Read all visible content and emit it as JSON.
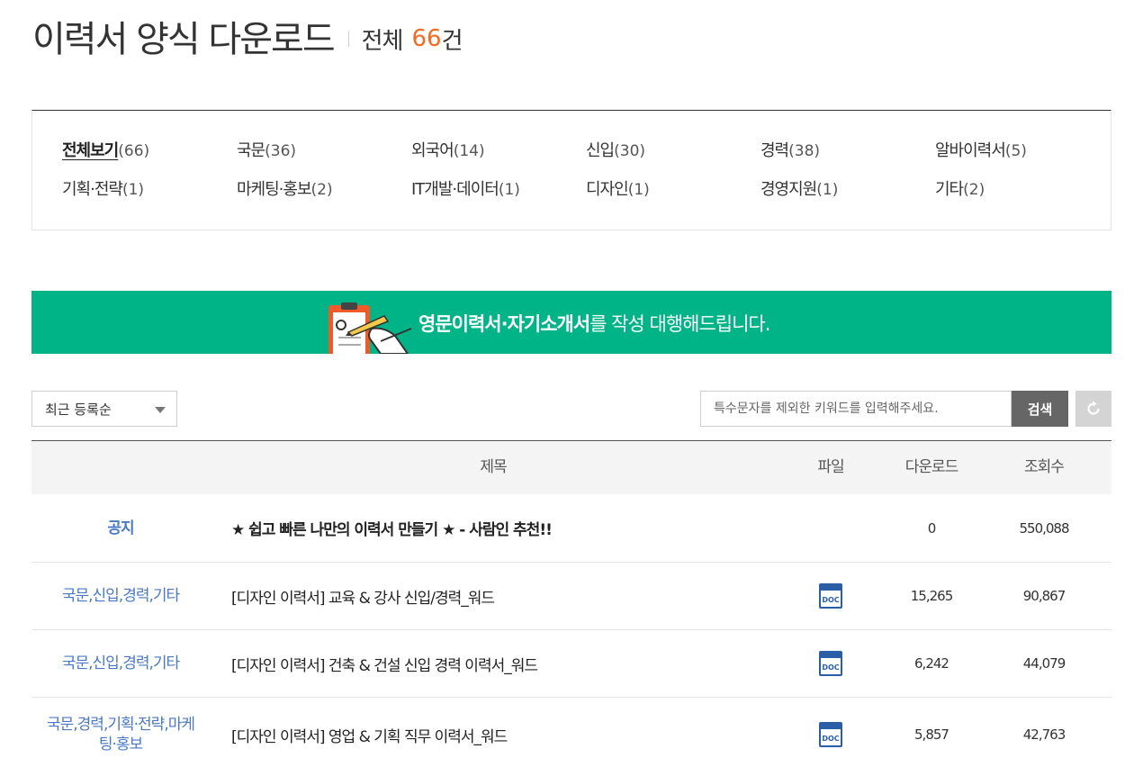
{
  "header": {
    "title": "이력서 양식 다운로드",
    "total_label": "전체",
    "total_count": "66",
    "total_unit": "건"
  },
  "categories": [
    {
      "name": "전체보기",
      "count": "(66)",
      "active": true
    },
    {
      "name": "국문",
      "count": "(36)"
    },
    {
      "name": "외국어",
      "count": "(14)"
    },
    {
      "name": "신입",
      "count": "(30)"
    },
    {
      "name": "경력",
      "count": "(38)"
    },
    {
      "name": "알바이력서",
      "count": "(5)"
    },
    {
      "name": "기획·전략",
      "count": "(1)"
    },
    {
      "name": "마케팅·홍보",
      "count": "(2)"
    },
    {
      "name": "IT개발·데이터",
      "count": "(1)"
    },
    {
      "name": "디자인",
      "count": "(1)"
    },
    {
      "name": "경영지원",
      "count": "(1)"
    },
    {
      "name": "기타",
      "count": "(2)"
    }
  ],
  "banner": {
    "bold_text": "영문이력서·자기소개서",
    "rest_text": "를 작성 대행해드립니다.",
    "color": "#00b488"
  },
  "toolbar": {
    "sort_value": "최근 등록순",
    "search_placeholder": "특수문자를 제외한 키워드를 입력해주세요.",
    "search_label": "검색"
  },
  "table": {
    "headers": {
      "title": "제목",
      "file": "파일",
      "downloads": "다운로드",
      "views": "조회수"
    },
    "rows": [
      {
        "category": "공지",
        "title": "★ 쉽고 빠른 나만의 이력서 만들기 ★ - 사람인 추천!!",
        "file": "",
        "downloads": "0",
        "views": "550,088",
        "notice": true
      },
      {
        "category": "국문,신입,경력,기타",
        "title": "[디자인 이력서] 교육 & 강사 신입/경력_워드",
        "file": "doc-icon",
        "downloads": "15,265",
        "views": "90,867"
      },
      {
        "category": "국문,신입,경력,기타",
        "title": "[디자인 이력서] 건축 & 건설 신입 경력 이력서_워드",
        "file": "doc-icon",
        "downloads": "6,242",
        "views": "44,079"
      },
      {
        "category": "국문,경력,기획·전략,마케팅·홍보",
        "title": "[디자인 이력서] 영업 & 기획 직무 이력서_워드",
        "file": "doc-icon",
        "downloads": "5,857",
        "views": "42,763"
      }
    ]
  },
  "colors": {
    "accent_orange": "#f26a21",
    "link_blue": "#4a79c8",
    "doc_blue": "#2a5fa8"
  }
}
